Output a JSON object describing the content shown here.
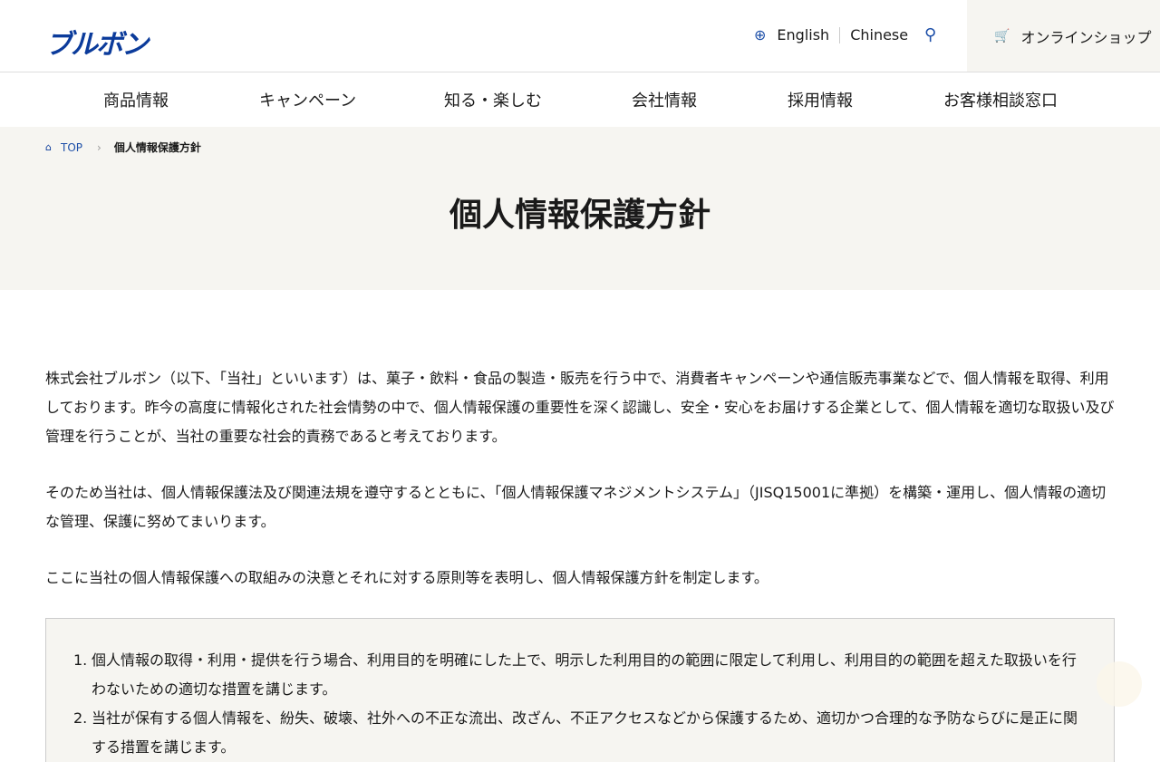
{
  "header": {
    "logo": "ブルボン",
    "lang_english": "English",
    "lang_chinese": "Chinese",
    "online_shop": "オンラインショップ"
  },
  "nav": [
    "商品情報",
    "キャンペーン",
    "知る・楽しむ",
    "会社情報",
    "採用情報",
    "お客様相談窓口"
  ],
  "breadcrumb": {
    "top": "TOP",
    "current": "個人情報保護方針"
  },
  "page_title": "個人情報保護方針",
  "paragraphs": [
    "株式会社ブルボン（以下、「当社」といいます）は、菓子・飲料・食品の製造・販売を行う中で、消費者キャンペーンや通信販売事業などで、個人情報を取得、利用しております。昨今の高度に情報化された社会情勢の中で、個人情報保護の重要性を深く認識し、安全・安心をお届けする企業として、個人情報を適切な取扱い及び管理を行うことが、当社の重要な社会的責務であると考えております。",
    "そのため当社は、個人情報保護法及び関連法規を遵守するとともに、「個人情報保護マネジメントシステム」（JISQ15001に準拠）を構築・運用し、個人情報の適切な管理、保護に努めてまいります。",
    "ここに当社の個人情報保護への取組みの決意とそれに対する原則等を表明し、個人情報保護方針を制定します。"
  ],
  "policy_items": [
    {
      "num": "1.",
      "text": "個人情報の取得・利用・提供を行う場合、利用目的を明確にした上で、明示した利用目的の範囲に限定して利用し、利用目的の範囲を超えた取扱いを行わないための適切な措置を講じます。"
    },
    {
      "num": "2.",
      "text": "当社が保有する個人情報を、紛失、破壊、社外への不正な流出、改ざん、不正アクセスなどから保護するため、適切かつ合理的な予防ならびに是正に関する措置を講じます。"
    }
  ]
}
